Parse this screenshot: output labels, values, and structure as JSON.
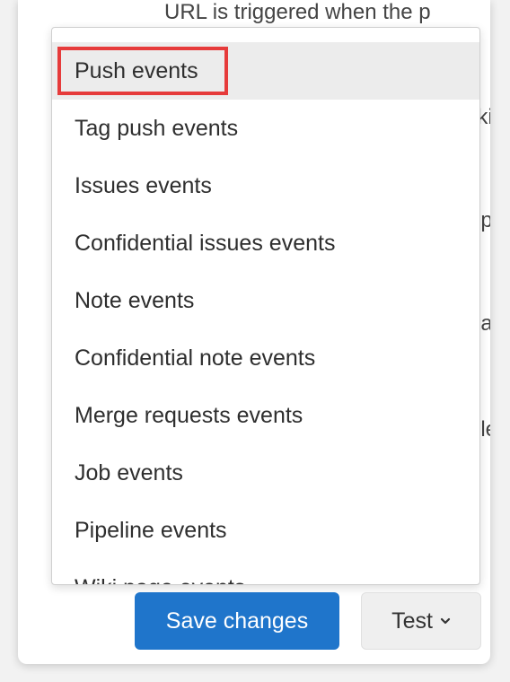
{
  "background_fragments": {
    "top_line": "URL is triggered when the p",
    "frag_1": "viki",
    "frag_2": "rep",
    "frag_3": "reat",
    "frag_4": "rele"
  },
  "dropdown": {
    "items": [
      {
        "label": "Push events",
        "highlighted": true
      },
      {
        "label": "Tag push events"
      },
      {
        "label": "Issues events"
      },
      {
        "label": "Confidential issues events"
      },
      {
        "label": "Note events"
      },
      {
        "label": "Confidential note events"
      },
      {
        "label": "Merge requests events"
      },
      {
        "label": "Job events"
      },
      {
        "label": "Pipeline events"
      },
      {
        "label": "Wiki page events"
      }
    ]
  },
  "actions": {
    "save_label": "Save changes",
    "test_label": "Test",
    "test_icon": "chevron-down-icon"
  },
  "colors": {
    "primary": "#1f75cb",
    "highlight_outline": "#e63b3b",
    "highlight_bg": "#ececec"
  }
}
